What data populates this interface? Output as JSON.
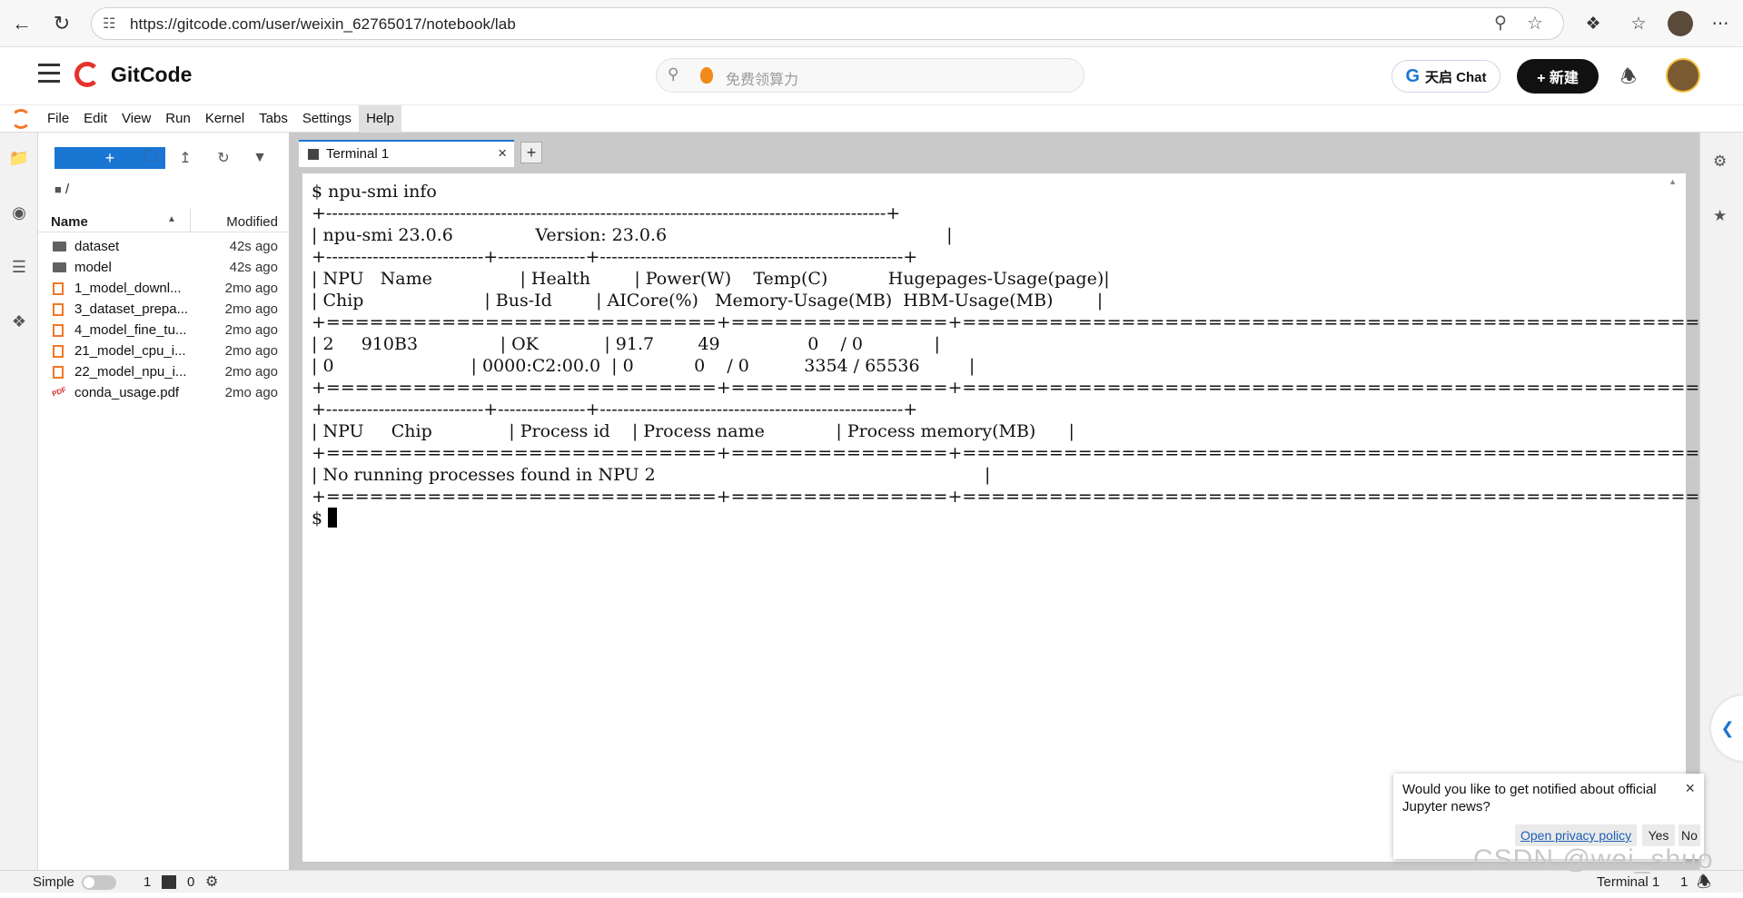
{
  "browser": {
    "url": "https://gitcode.com/user/weixin_62765017/notebook/lab"
  },
  "site": {
    "logo_text": "GitCode",
    "search_placeholder": "免费领算力",
    "tq_chat_label": "天启 Chat",
    "new_button_label": "+ 新建"
  },
  "menubar": {
    "items": [
      "File",
      "Edit",
      "View",
      "Run",
      "Kernel",
      "Tabs",
      "Settings",
      "Help"
    ]
  },
  "file_browser": {
    "new_button_label": "+",
    "breadcrumb": "/",
    "col_name": "Name",
    "col_modified": "Modified",
    "files": [
      {
        "name": "dataset",
        "modified": "42s ago",
        "kind": "folder"
      },
      {
        "name": "model",
        "modified": "42s ago",
        "kind": "folder"
      },
      {
        "name": "1_model_downl...",
        "modified": "2mo ago",
        "kind": "notebook"
      },
      {
        "name": "3_dataset_prepa...",
        "modified": "2mo ago",
        "kind": "notebook"
      },
      {
        "name": "4_model_fine_tu...",
        "modified": "2mo ago",
        "kind": "notebook"
      },
      {
        "name": "21_model_cpu_i...",
        "modified": "2mo ago",
        "kind": "notebook"
      },
      {
        "name": "22_model_npu_i...",
        "modified": "2mo ago",
        "kind": "notebook"
      },
      {
        "name": "conda_usage.pdf",
        "modified": "2mo ago",
        "kind": "pdf"
      }
    ]
  },
  "tabs": {
    "terminal_label": "Terminal 1",
    "add_label": "+"
  },
  "terminal": {
    "lines": [
      "$ npu-smi info",
      "+------------------------------------------------------------------------------------------------+",
      "| npu-smi 23.0.6               Version: 23.0.6                                                   |",
      "+---------------------------+---------------+----------------------------------------------------+",
      "| NPU   Name                | Health        | Power(W)    Temp(C)           Hugepages-Usage(page)|",
      "| Chip                      | Bus-Id        | AICore(%)   Memory-Usage(MB)  HBM-Usage(MB)        |",
      "+===========================+===============+====================================================+",
      "| 2     910B3               | OK            | 91.7        49                0    / 0             |",
      "| 0                         | 0000:C2:00.0  | 0           0    / 0          3354 / 65536         |",
      "+===========================+===============+====================================================+",
      "+---------------------------+---------------+----------------------------------------------------+",
      "| NPU     Chip              | Process id    | Process name             | Process memory(MB)      |",
      "+===========================+===============+====================================================+",
      "| No running processes found in NPU 2                                                            |",
      "+===========================+===============+====================================================+",
      "$ "
    ]
  },
  "statusbar": {
    "mode_label": "Simple",
    "terminals_count": "1",
    "kernels_count": "0",
    "right_label": "Terminal 1",
    "right_count": "1"
  },
  "notification": {
    "message": "Would you like to get notified about official Jupyter news?",
    "privacy_label": "Open privacy policy",
    "yes_label": "Yes",
    "no_label": "No"
  },
  "watermark": "CSDN @wei_shuo",
  "colors": {
    "accent": "#1976d2",
    "gitcode_red": "#e5322d",
    "notebook_orange": "#f37726"
  }
}
